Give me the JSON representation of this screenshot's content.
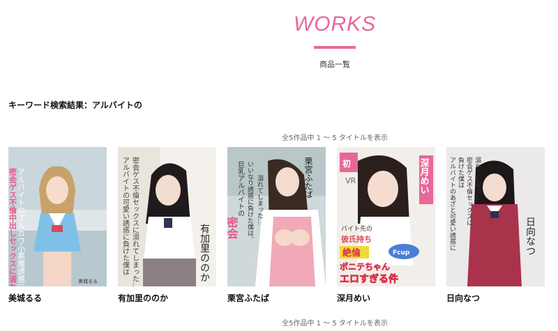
{
  "header": {
    "title": "WORKS",
    "subtitle": "商品一覧",
    "accent_color": "#e8679a"
  },
  "search": {
    "heading": "キーワード検索結果：アルバイトの"
  },
  "pagination": {
    "count_text": "全5作品中 1 〜 5 タイトルを表示"
  },
  "works": [
    {
      "name": "美城るる",
      "cover_texts": [
        "アルバイトのズルカワ小悪魔誘惑に負けた僕は、",
        "密会ゲス不倫中出しセックスに溺れてしまった…",
        "美城るる"
      ]
    },
    {
      "name": "有加里ののか",
      "cover_texts": [
        "アルバイトの可愛い誘惑に負けた僕は",
        "密会ゲス不倫セックスに溺れてしまった…",
        "有加里ののか"
      ]
    },
    {
      "name": "栗宮ふたば",
      "cover_texts": [
        "巨乳アルバイトの",
        "いいなり誘惑に負けた僕は、",
        "密会",
        "溺れてしまった…",
        "栗宮ふたば"
      ]
    },
    {
      "name": "深月めい",
      "cover_texts": [
        "初",
        "VR",
        "深月めい",
        "バイト先の",
        "彼氏持ち",
        "絶倫",
        "ポニテちゃん",
        "Fcup",
        "エロすぎる件"
      ]
    },
    {
      "name": "日向なつ",
      "cover_texts": [
        "アルバイトのあざと可愛い誘惑に",
        "負けた僕は",
        "密会ゲス不倫セックスに",
        "溺れてしまった…",
        "日向なつ"
      ]
    }
  ]
}
